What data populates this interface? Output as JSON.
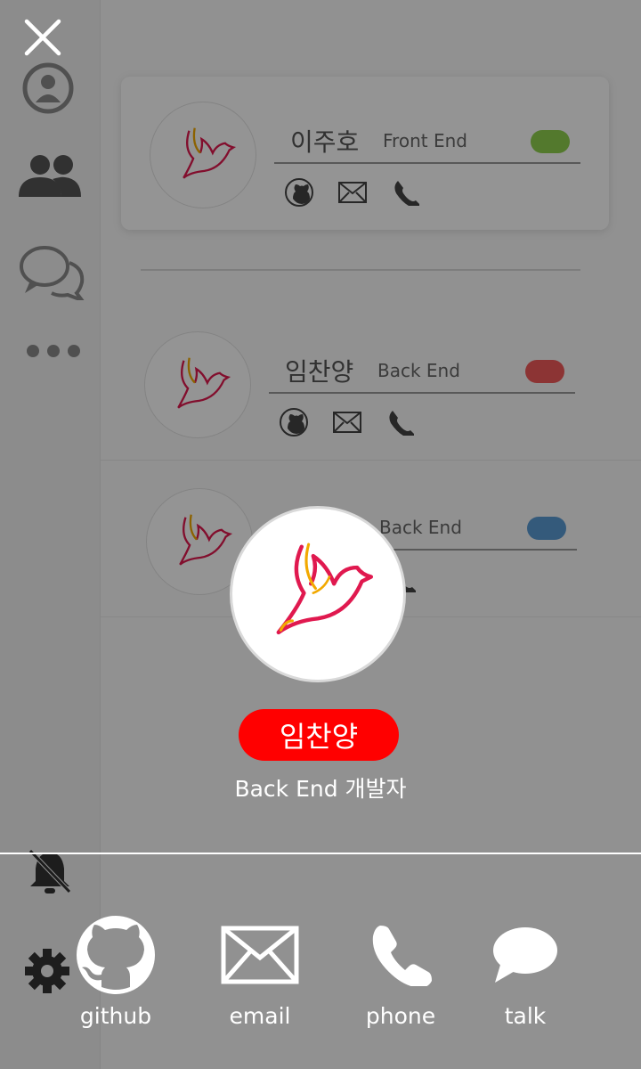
{
  "members": [
    {
      "name": "이주호",
      "role": "Front End",
      "color": "#8fd14f"
    },
    {
      "name": "임찬양",
      "role": "Back End",
      "color": "#f15a5a"
    },
    {
      "name": "",
      "role": "Back End",
      "color": "#5b9bd5"
    }
  ],
  "sidebar": {
    "icons": [
      "user-circle-icon",
      "people-icon",
      "chat-icon",
      "more-icon",
      "bell-off-icon",
      "gear-icon"
    ]
  },
  "profile": {
    "name": "임찬양",
    "subtitle": "Back End 개발자",
    "badge_color": "#ff0000"
  },
  "actions": [
    {
      "label": "github",
      "icon": "github-icon"
    },
    {
      "label": "email",
      "icon": "email-icon"
    },
    {
      "label": "phone",
      "icon": "phone-icon"
    },
    {
      "label": "talk",
      "icon": "talk-icon"
    }
  ]
}
